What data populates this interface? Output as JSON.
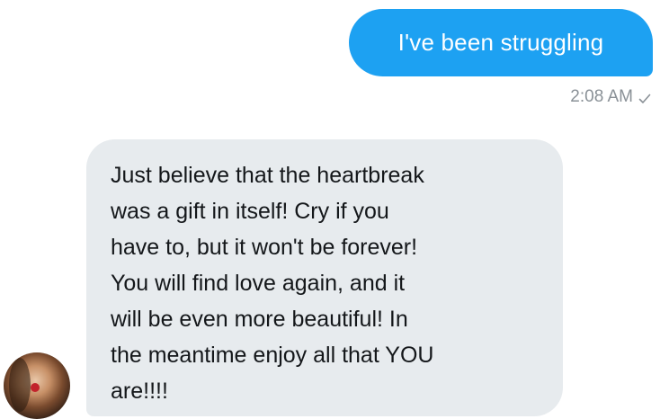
{
  "messages": [
    {
      "direction": "outgoing",
      "text": "I've been struggling",
      "time": "2:08 AM",
      "status_icon": "check-icon"
    },
    {
      "direction": "incoming",
      "text": "Just believe that the heartbreak\nwas a gift in itself! Cry if you\nhave to, but it won't be forever!\nYou will find love again, and it\nwill be even more beautiful! In\nthe meantime enjoy all that YOU\nare!!!!",
      "avatar_icon": "avatar"
    }
  ],
  "colors": {
    "outgoing_bubble": "#1da1f2",
    "incoming_bubble": "#e7ebee",
    "meta_text": "#8a9197",
    "message_text": "#14171a"
  }
}
